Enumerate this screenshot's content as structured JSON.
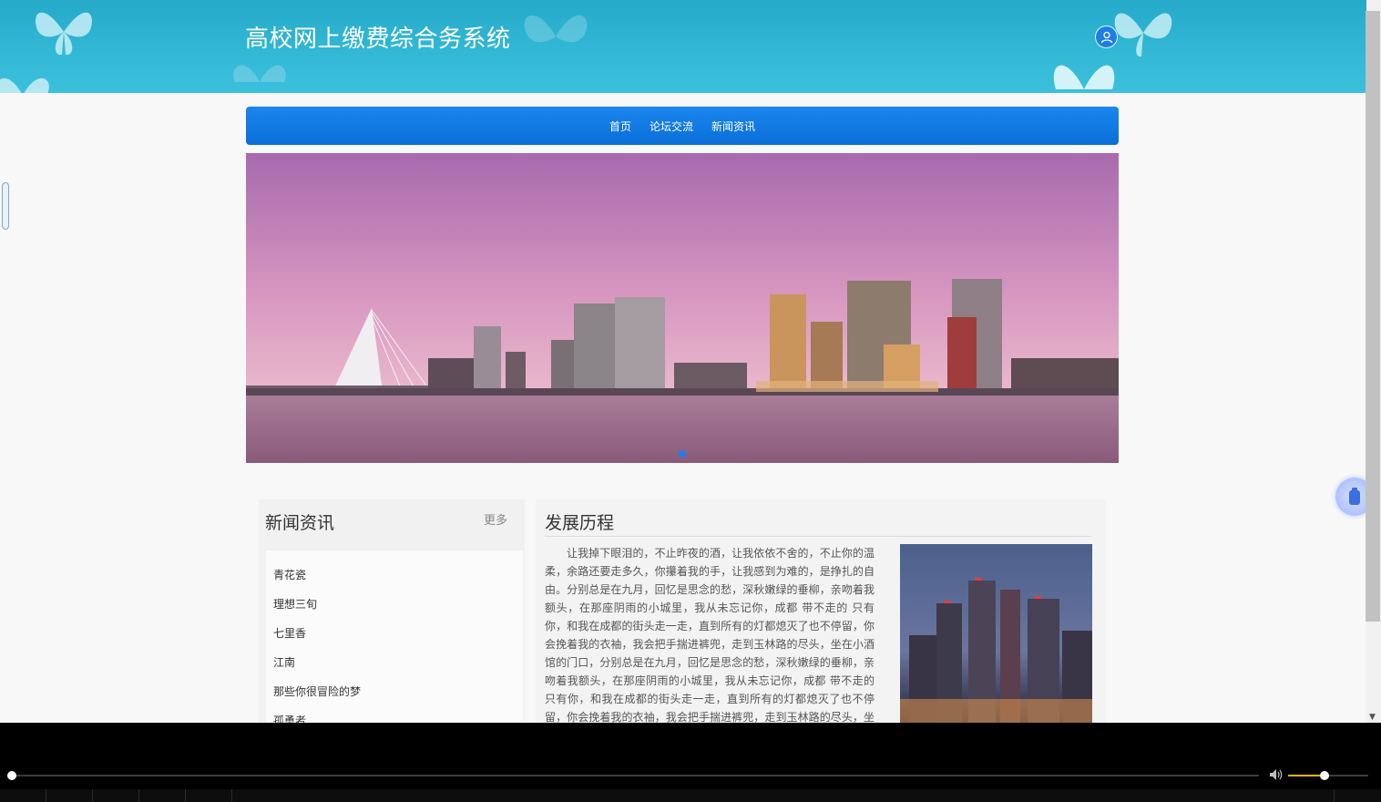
{
  "header": {
    "site_title": "高校网上缴费综合务系统"
  },
  "nav": {
    "items": [
      "首页",
      "论坛交流",
      "新闻资讯"
    ]
  },
  "news": {
    "title": "新闻资讯",
    "more": "更多",
    "items": [
      "青花瓷",
      "理想三旬",
      "七里香",
      "江南",
      "那些你很冒险的梦",
      "孤勇者"
    ]
  },
  "history": {
    "title": "发展历程",
    "text": "让我掉下眼泪的，不止昨夜的酒，让我依依不舍的，不止你的温柔，余路还要走多久，你攥着我的手，让我感到为难的，是挣扎的自由。分别总是在九月，回忆是思念的愁，深秋嫩绿的垂柳，亲吻着我额头，在那座阴雨的小城里，我从未忘记你，成都 带不走的 只有你，和我在成都的街头走一走，直到所有的灯都熄灭了也不停留，你会挽着我的衣袖，我会把手揣进裤兜，走到玉林路的尽头，坐在小酒馆的门口，分别总是在九月，回忆是思念的愁，深秋嫩绿的垂柳，亲吻着我额头，在那座阴雨的小城里，我从未忘记你，成都 带不走的 只有你，和我在成都的街头走一走，直到所有的灯都熄灭了也不停留，你会挽着我的衣袖，我会把手揣进裤兜，走到玉林路的尽头，坐在小酒馆的门口，和我"
  },
  "colors": {
    "header": "#33b9d6",
    "nav": "#0b6fd8",
    "accent": "#1e7fe8",
    "volume": "#f2b400"
  },
  "icons": {
    "user": "user-icon",
    "volume": "speaker-icon",
    "float": "clip-icon"
  },
  "player": {
    "seek_progress": 0.0,
    "volume_level": 0.45
  }
}
